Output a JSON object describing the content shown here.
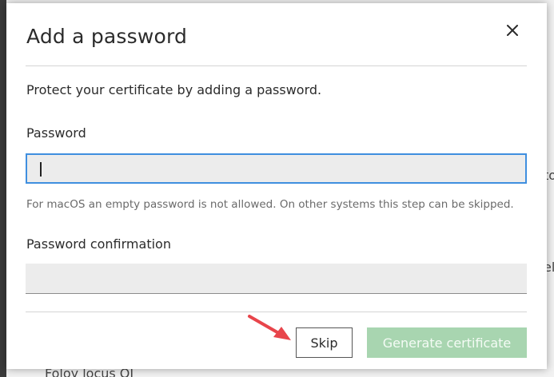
{
  "backdrop": {
    "fragment_1": "to",
    "fragment_2": "el",
    "fragment_3": "Foloy locus OI"
  },
  "dialog": {
    "title": "Add a password",
    "close_icon": "close-icon",
    "intro": "Protect your certificate by adding a password.",
    "password": {
      "label": "Password",
      "value": "",
      "placeholder": ""
    },
    "hint": "For macOS an empty password is not allowed. On other systems this step can be skipped.",
    "password_confirmation": {
      "label": "Password confirmation",
      "value": "",
      "placeholder": ""
    },
    "buttons": {
      "skip": "Skip",
      "generate": "Generate certificate"
    }
  },
  "colors": {
    "focus_border": "#3f8fdf",
    "primary_disabled": "#a8d5b0",
    "annotation_arrow": "#e8454b"
  }
}
